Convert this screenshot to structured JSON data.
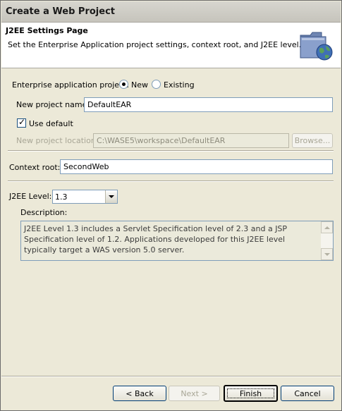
{
  "window": {
    "title": "Create a Web Project"
  },
  "header": {
    "title": "J2EE Settings Page",
    "description": "Set the Enterprise Application project settings, context root, and J2EE level.",
    "icon": "web-project-wizard-icon"
  },
  "ear": {
    "label": "Enterprise application project:",
    "options": [
      {
        "label": "New",
        "selected": true
      },
      {
        "label": "Existing",
        "selected": false
      }
    ],
    "name_label": "New project name:",
    "name_value": "DefaultEAR",
    "use_default_label": "Use default",
    "use_default_checked": true,
    "location_label": "New project location:",
    "location_value": "C:\\WASE5\\workspace\\DefaultEAR",
    "browse_label": "Browse..."
  },
  "context": {
    "label": "Context root:",
    "value": "SecondWeb"
  },
  "j2ee": {
    "label": "J2EE Level:",
    "value": "1.3",
    "description_label": "Description:",
    "description_text": "J2EE Level 1.3 includes a Servlet Specification level of 2.3 and a JSP Specification level of 1.2.  Applications developed for this J2EE level typically target a WAS version 5.0 server."
  },
  "buttons": {
    "back": "< Back",
    "next": "Next >",
    "finish": "Finish",
    "cancel": "Cancel"
  }
}
